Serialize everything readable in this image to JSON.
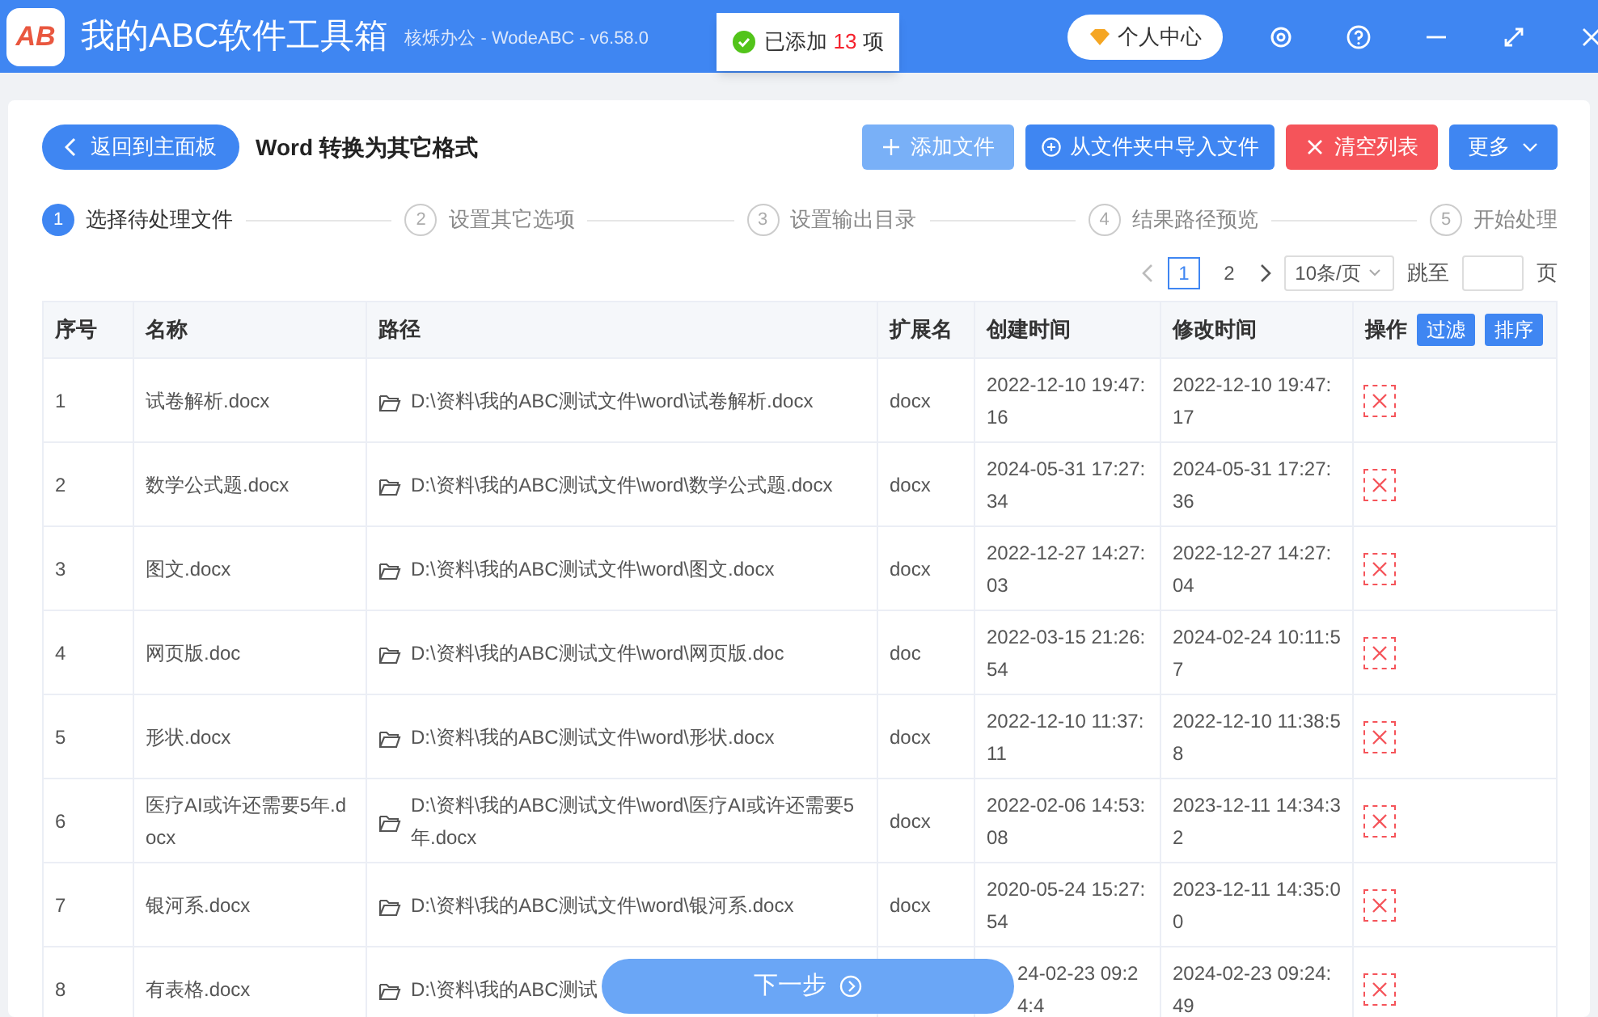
{
  "app": {
    "logo": "AB",
    "title": "我的ABC软件工具箱",
    "subtitle": "核烁办公 - WodeABC - v6.58.0",
    "user_button": "个人中心"
  },
  "toast": {
    "prefix": "已添加",
    "count": "13",
    "suffix": "项"
  },
  "toolbar": {
    "back": "返回到主面板",
    "page_title": "Word 转换为其它格式",
    "buttons": [
      {
        "kind": "add",
        "label": "添加文件"
      },
      {
        "kind": "import",
        "label": "从文件夹中导入文件"
      },
      {
        "kind": "clear",
        "label": "清空列表"
      },
      {
        "kind": "more",
        "label": "更多"
      }
    ]
  },
  "steps": [
    {
      "num": "1",
      "label": "选择待处理文件",
      "selected": true
    },
    {
      "num": "2",
      "label": "设置其它选项",
      "selected": false
    },
    {
      "num": "3",
      "label": "设置输出目录",
      "selected": false
    },
    {
      "num": "4",
      "label": "结果路径预览",
      "selected": false
    },
    {
      "num": "5",
      "label": "开始处理",
      "selected": false
    }
  ],
  "pagination": {
    "pages": [
      {
        "label": "1",
        "selected": true
      },
      {
        "label": "2",
        "selected": false
      }
    ],
    "page_size": "10条/页",
    "jump_label": "跳至",
    "page_unit": "页"
  },
  "table": {
    "columns": [
      "序号",
      "名称",
      "路径",
      "扩展名",
      "创建时间",
      "修改时间",
      "操作"
    ],
    "filter_button": "过滤",
    "sort_button": "排序",
    "rows": [
      {
        "index": "1",
        "name": "试卷解析.docx",
        "path": "D:\\资料\\我的ABC测试文件\\word\\试卷解析.docx",
        "ext": "docx",
        "created": "2022-12-10 19:47:16",
        "modified": "2022-12-10 19:47:17"
      },
      {
        "index": "2",
        "name": "数学公式题.docx",
        "path": "D:\\资料\\我的ABC测试文件\\word\\数学公式题.docx",
        "ext": "docx",
        "created": "2024-05-31 17:27:34",
        "modified": "2024-05-31 17:27:36"
      },
      {
        "index": "3",
        "name": "图文.docx",
        "path": "D:\\资料\\我的ABC测试文件\\word\\图文.docx",
        "ext": "docx",
        "created": "2022-12-27 14:27:03",
        "modified": "2022-12-27 14:27:04"
      },
      {
        "index": "4",
        "name": "网页版.doc",
        "path": "D:\\资料\\我的ABC测试文件\\word\\网页版.doc",
        "ext": "doc",
        "created": "2022-03-15 21:26:54",
        "modified": "2024-02-24 10:11:57"
      },
      {
        "index": "5",
        "name": "形状.docx",
        "path": "D:\\资料\\我的ABC测试文件\\word\\形状.docx",
        "ext": "docx",
        "created": "2022-12-10 11:37:11",
        "modified": "2022-12-10 11:38:58"
      },
      {
        "index": "6",
        "name": "医疗AI或许还需要5年.docx",
        "path": "D:\\资料\\我的ABC测试文件\\word\\医疗AI或许还需要5年.docx",
        "ext": "docx",
        "created": "2022-02-06 14:53:08",
        "modified": "2023-12-11 14:34:32"
      },
      {
        "index": "7",
        "name": "银河系.docx",
        "path": "D:\\资料\\我的ABC测试文件\\word\\银河系.docx",
        "ext": "docx",
        "created": "2020-05-24 15:27:54",
        "modified": "2023-12-11 14:35:00"
      },
      {
        "index": "8",
        "name": "有表格.docx",
        "path": "D:\\资料\\我的ABC测试",
        "created": "24-02-23 09:24:4",
        "modified": "2024-02-23 09:24:49"
      }
    ]
  },
  "next_button": "下一步"
}
